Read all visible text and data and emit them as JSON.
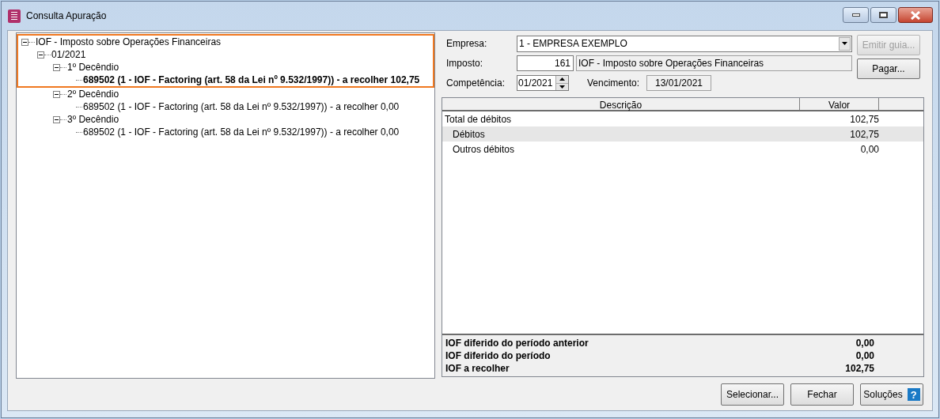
{
  "window": {
    "title": "Consulta Apuração"
  },
  "tree": [
    {
      "label": "IOF - Imposto sobre Operações Financeiras",
      "expanded": true,
      "highlighted": true,
      "selected": false,
      "children": [
        {
          "label": "01/2021",
          "expanded": true,
          "highlighted": true,
          "selected": false,
          "children": [
            {
              "label": "1º Decêndio",
              "expanded": true,
              "highlighted": true,
              "selected": false,
              "children": [
                {
                  "label": "689502 (1 - IOF - Factoring (art. 58 da Lei nº 9.532/1997)) - a recolher 102,75",
                  "highlighted": true,
                  "selected": true
                }
              ]
            },
            {
              "label": "2º Decêndio",
              "expanded": true,
              "highlighted": false,
              "selected": false,
              "children": [
                {
                  "label": "689502 (1 - IOF - Factoring (art. 58 da Lei nº 9.532/1997)) - a recolher 0,00",
                  "highlighted": false,
                  "selected": false
                }
              ]
            },
            {
              "label": "3º Decêndio",
              "expanded": true,
              "highlighted": false,
              "selected": false,
              "children": [
                {
                  "label": "689502 (1 - IOF - Factoring (art. 58 da Lei nº 9.532/1997)) - a recolher 0,00",
                  "highlighted": false,
                  "selected": false
                }
              ]
            }
          ]
        }
      ]
    }
  ],
  "form": {
    "empresa_label": "Empresa:",
    "empresa_value": "1 - EMPRESA EXEMPLO",
    "imposto_label": "Imposto:",
    "imposto_code": "161",
    "imposto_name": "IOF - Imposto sobre Operações Financeiras",
    "competencia_label": "Competência:",
    "competencia_value": "01/2021",
    "vencimento_label": "Vencimento:",
    "vencimento_value": "13/01/2021"
  },
  "side_buttons": [
    {
      "label": "Emitir guia...",
      "disabled": true
    },
    {
      "label": "Pagar...",
      "disabled": false
    }
  ],
  "table": {
    "columns": [
      "Descrição",
      "Valor"
    ],
    "rows": [
      {
        "descricao": "Total de débitos",
        "valor": "102,75",
        "selected": false,
        "children": [
          {
            "descricao": "Débitos",
            "valor": "102,75",
            "selected": true
          },
          {
            "descricao": "Outros débitos",
            "valor": "0,00",
            "selected": false
          }
        ]
      }
    ]
  },
  "summary": [
    {
      "label": "IOF diferido do período anterior",
      "value": "0,00"
    },
    {
      "label": "IOF diferido do período",
      "value": "0,00"
    },
    {
      "label": "IOF a recolher",
      "value": "102,75"
    }
  ],
  "buttons": [
    {
      "kind": "plain",
      "label": "Selecionar..."
    },
    {
      "kind": "plain",
      "label": "Fechar"
    },
    {
      "kind": "help",
      "label": "Soluções",
      "icon_text": "?"
    }
  ]
}
